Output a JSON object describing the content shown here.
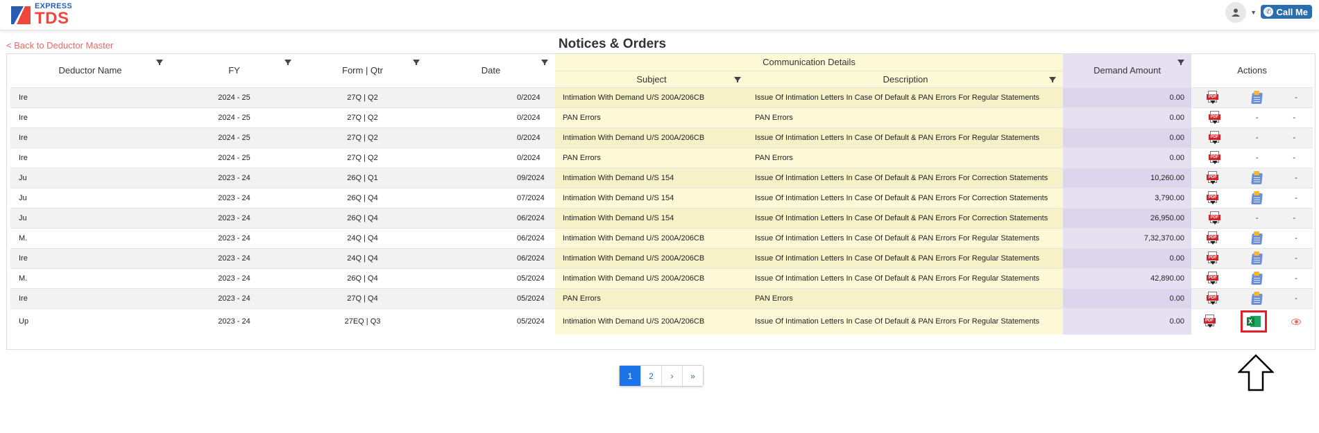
{
  "brand": {
    "express": "EXPRESS",
    "tds": "TDS"
  },
  "header": {
    "call_me": "Call Me"
  },
  "nav": {
    "back_link": "< Back to Deductor Master"
  },
  "page": {
    "title": "Notices & Orders"
  },
  "table": {
    "headers": {
      "deductor_name": "Deductor Name",
      "fy": "FY",
      "form_qtr": "Form | Qtr",
      "date": "Date",
      "communication_details": "Communication Details",
      "subject": "Subject",
      "description": "Description",
      "demand_amount": "Demand Amount",
      "actions": "Actions"
    },
    "rows": [
      {
        "name": "Ire",
        "fy": "2024 - 25",
        "form": "27Q | Q2",
        "date": "0/2024",
        "subject": "Intimation With Demand U/S 200A/206CB",
        "description": "Issue Of Intimation Letters In Case Of Default & PAN Errors For Regular Statements",
        "amount": "0.00",
        "action2": "note",
        "action3": "-"
      },
      {
        "name": "Ire",
        "fy": "2024 - 25",
        "form": "27Q | Q2",
        "date": "0/2024",
        "subject": "PAN Errors",
        "description": "PAN Errors",
        "amount": "0.00",
        "action2": "-",
        "action3": "-"
      },
      {
        "name": "Ire",
        "fy": "2024 - 25",
        "form": "27Q | Q2",
        "date": "0/2024",
        "subject": "Intimation With Demand U/S 200A/206CB",
        "description": "Issue Of Intimation Letters In Case Of Default & PAN Errors For Regular Statements",
        "amount": "0.00",
        "action2": "-",
        "action3": "-"
      },
      {
        "name": "Ire",
        "fy": "2024 - 25",
        "form": "27Q | Q2",
        "date": "0/2024",
        "subject": "PAN Errors",
        "description": "PAN Errors",
        "amount": "0.00",
        "action2": "-",
        "action3": "-"
      },
      {
        "name": "Ju",
        "fy": "2023 - 24",
        "form": "26Q | Q1",
        "date": "09/2024",
        "subject": "Intimation With Demand U/S 154",
        "description": "Issue Of Intimation Letters In Case Of Default & PAN Errors For Correction Statements",
        "amount": "10,260.00",
        "action2": "note",
        "action3": "-"
      },
      {
        "name": "Ju",
        "fy": "2023 - 24",
        "form": "26Q | Q4",
        "date": "07/2024",
        "subject": "Intimation With Demand U/S 154",
        "description": "Issue Of Intimation Letters In Case Of Default & PAN Errors For Correction Statements",
        "amount": "3,790.00",
        "action2": "note",
        "action3": "-"
      },
      {
        "name": "Ju",
        "fy": "2023 - 24",
        "form": "26Q | Q4",
        "date": "06/2024",
        "subject": "Intimation With Demand U/S 154",
        "description": "Issue Of Intimation Letters In Case Of Default & PAN Errors For Correction Statements",
        "amount": "26,950.00",
        "action2": "-",
        "action3": "-"
      },
      {
        "name": "M.",
        "fy": "2023 - 24",
        "form": "24Q | Q4",
        "date": "06/2024",
        "subject": "Intimation With Demand U/S 200A/206CB",
        "description": "Issue Of Intimation Letters In Case Of Default & PAN Errors For Regular Statements",
        "amount": "7,32,370.00",
        "action2": "note",
        "action3": "-"
      },
      {
        "name": "Ire",
        "fy": "2023 - 24",
        "form": "24Q | Q4",
        "date": "06/2024",
        "subject": "Intimation With Demand U/S 200A/206CB",
        "description": "Issue Of Intimation Letters In Case Of Default & PAN Errors For Regular Statements",
        "amount": "0.00",
        "action2": "note",
        "action3": "-"
      },
      {
        "name": "M.",
        "fy": "2023 - 24",
        "form": "26Q | Q4",
        "date": "05/2024",
        "subject": "Intimation With Demand U/S 200A/206CB",
        "description": "Issue Of Intimation Letters In Case Of Default & PAN Errors For Regular Statements",
        "amount": "42,890.00",
        "action2": "note",
        "action3": "-"
      },
      {
        "name": "Ire",
        "fy": "2023 - 24",
        "form": "27Q | Q4",
        "date": "05/2024",
        "subject": "PAN Errors",
        "description": "PAN Errors",
        "amount": "0.00",
        "action2": "note",
        "action3": "-"
      },
      {
        "name": "Up",
        "fy": "2023 - 24",
        "form": "27EQ | Q3",
        "date": "05/2024",
        "subject": "Intimation With Demand U/S 200A/206CB",
        "description": "Issue Of Intimation Letters In Case Of Default & PAN Errors For Regular Statements",
        "amount": "0.00",
        "action2": "excel",
        "action3": "eye"
      }
    ]
  },
  "pagination": {
    "pages": [
      "1",
      "2"
    ],
    "next": "›",
    "last": "»",
    "current": "1"
  },
  "colors": {
    "brand_red": "#f0473d",
    "brand_blue": "#2a5db0",
    "subject_bg": "#fdf9d6",
    "amount_bg": "#e6e1f2",
    "highlight_box": "#e0202a"
  }
}
